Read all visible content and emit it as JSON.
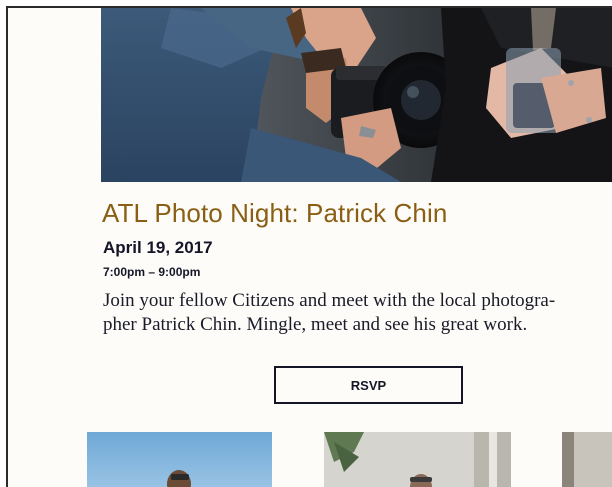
{
  "event": {
    "title": "ATL Photo Night: Patrick Chin",
    "date": "April 19, 2017",
    "time": "7:00pm – 9:00pm",
    "description_line1": "Join your fellow Citizens and meet with the local photogra-",
    "description_line2": "pher Patrick Chin. Mingle, meet and see his great work.",
    "rsvp_label": "RSVP"
  },
  "colors": {
    "title": "#8a5f14",
    "text": "#151528",
    "page_background": "#fdfcf9"
  }
}
